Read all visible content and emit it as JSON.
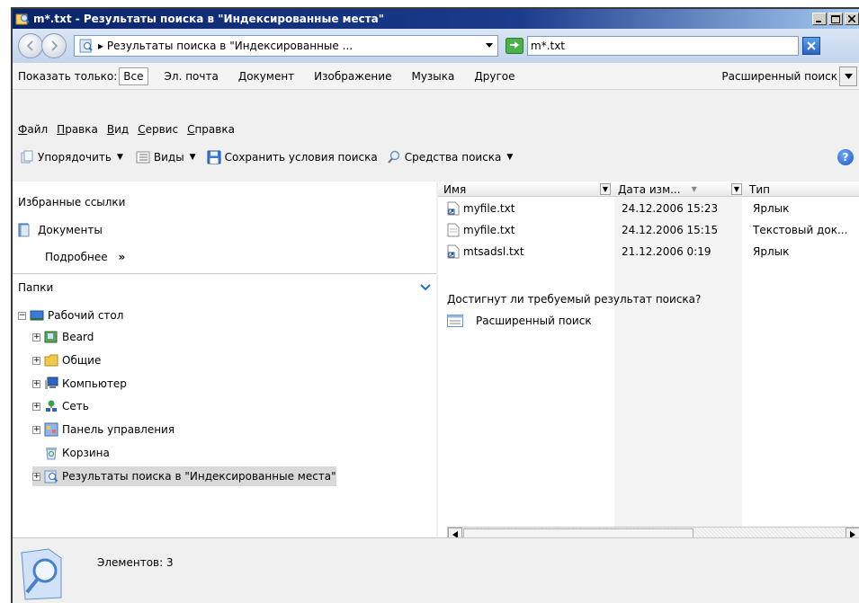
{
  "window": {
    "title": "m*.txt - Результаты поиска в \"Индексированные места\""
  },
  "address": {
    "breadcrumb": "▸ Результаты поиска в \"Индексированные ...",
    "search_value": "m*.txt"
  },
  "filter": {
    "label": "Показать только:",
    "types": [
      "Все",
      "Эл. почта",
      "Документ",
      "Изображение",
      "Музыка",
      "Другое"
    ],
    "advanced": "Расширенный поиск"
  },
  "menu": [
    "Файл",
    "Правка",
    "Вид",
    "Сервис",
    "Справка"
  ],
  "toolbar": {
    "organize": "Упорядочить",
    "views": "Виды",
    "save_search": "Сохранить условия поиска",
    "search_tools": "Средства поиска"
  },
  "favorites": {
    "title": "Избранные ссылки",
    "documents": "Документы",
    "more": "Подробнее",
    "more_chevron": "»"
  },
  "folders": {
    "title": "Папки",
    "tree": [
      "Рабочий стол",
      "Beard",
      "Общие",
      "Компьютер",
      "Сеть",
      "Панель управления",
      "Корзина",
      "Результаты поиска в \"Индексированные места\""
    ]
  },
  "file_list": {
    "columns": [
      "Имя",
      "Дата изм...",
      "Тип"
    ],
    "rows": [
      {
        "name": "myfile.txt",
        "date": "24.12.2006 15:23",
        "type": "Ярлык"
      },
      {
        "name": "myfile.txt",
        "date": "24.12.2006 15:15",
        "type": "Текстовый док..."
      },
      {
        "name": "mtsadsl.txt",
        "date": "21.12.2006 0:19",
        "type": "Ярлык"
      }
    ],
    "question": "Достигнут ли требуемый результат поиска?",
    "advanced_link": "Расширенный поиск"
  },
  "details": {
    "count": "Элементов: 3"
  },
  "colors": {
    "titlebar_start": "#0a246a",
    "titlebar_end": "#a6caf0",
    "chrome_bg": "#f0f0f0",
    "accent_blue": "#1f6fc9"
  }
}
